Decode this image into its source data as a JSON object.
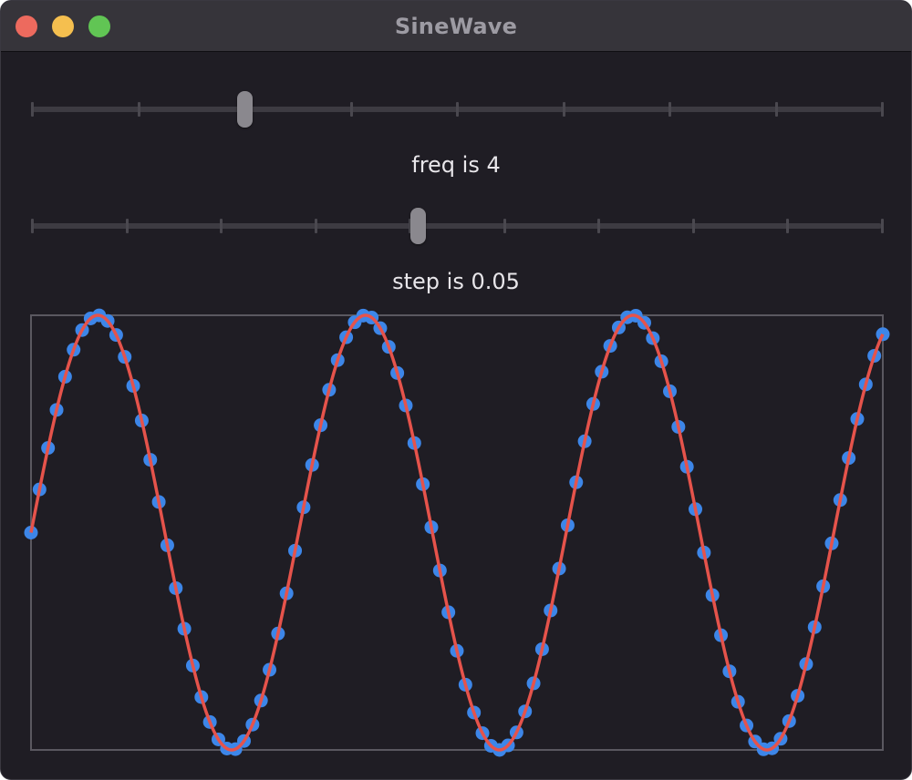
{
  "window": {
    "title": "SineWave"
  },
  "controls": {
    "freq": {
      "label": "freq is 4",
      "value": 4,
      "min": 0,
      "max": 16,
      "ticks": 9
    },
    "step": {
      "label": "step is 0.05",
      "value": 0.05,
      "min": 0,
      "max": 0.11,
      "ticks": 10
    }
  },
  "colors": {
    "line": "#e5534b",
    "points": "#3d86e8",
    "frame": "#5a5860"
  },
  "chart_data": {
    "type": "line",
    "function": "sin",
    "frequency": 4,
    "step": 0.05,
    "x_range": [
      0,
      5.0
    ],
    "ylim": [
      -1,
      1
    ],
    "grid": false,
    "series": [
      {
        "kind": "curve"
      },
      {
        "kind": "sampled-points"
      }
    ]
  }
}
